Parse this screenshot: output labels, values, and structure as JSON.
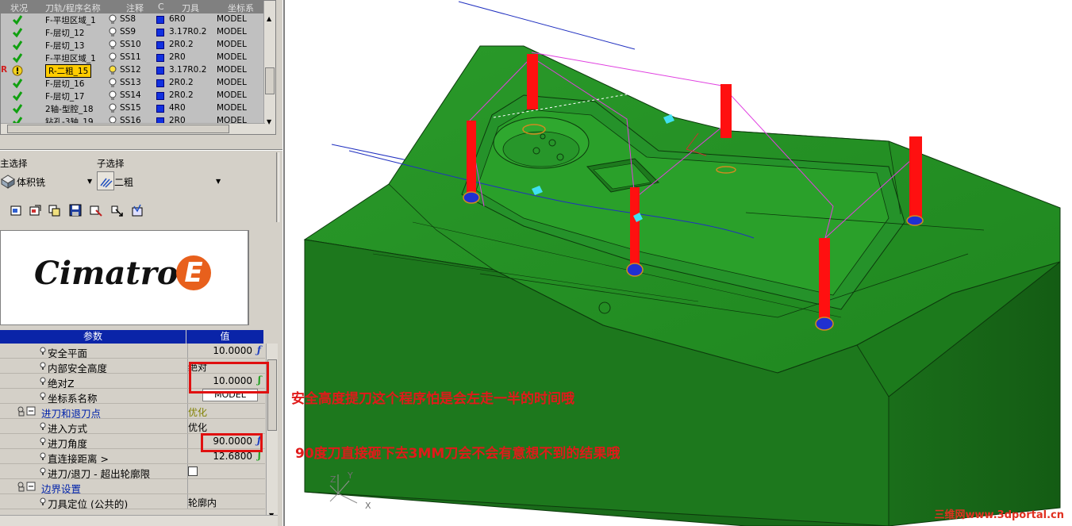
{
  "program_list": {
    "headers": [
      "状况",
      "刀轨/程序名称",
      "注释",
      "C",
      "刀具",
      "坐标系"
    ],
    "rows": [
      {
        "status": "ok",
        "name": "F-平坦区域_1",
        "note": "SS8",
        "tool": "6R0",
        "coord": "MODEL"
      },
      {
        "status": "ok",
        "name": "F-层切_12",
        "note": "SS9",
        "tool": "3.17R0.2",
        "coord": "MODEL"
      },
      {
        "status": "ok",
        "name": "F-层切_13",
        "note": "SS10",
        "tool": "2R0.2",
        "coord": "MODEL"
      },
      {
        "status": "ok",
        "name": "F-平坦区域_1",
        "note": "SS11",
        "tool": "2R0",
        "coord": "MODEL"
      },
      {
        "status": "warn",
        "name": "R-二粗_15",
        "note": "SS12",
        "tool": "3.17R0.2",
        "coord": "MODEL",
        "marker": "R"
      },
      {
        "status": "ok",
        "name": "F-层切_16",
        "note": "SS13",
        "tool": "2R0.2",
        "coord": "MODEL"
      },
      {
        "status": "ok",
        "name": "F-层切_17",
        "note": "SS14",
        "tool": "2R0.2",
        "coord": "MODEL"
      },
      {
        "status": "ok",
        "name": "2轴-型腔_18",
        "note": "SS15",
        "tool": "4R0",
        "coord": "MODEL"
      },
      {
        "status": "ok",
        "name": "钻孔-3轴_19",
        "note": "SS16",
        "tool": "2R0",
        "coord": "MODEL"
      }
    ]
  },
  "selection": {
    "main_label": "主选择",
    "main_value": "体积铣",
    "sub_label": "子选择",
    "sub_value": "二粗"
  },
  "logo": {
    "text": "Cimatron",
    "letter": "E"
  },
  "params": {
    "header_name": "参数",
    "header_value": "值",
    "rows": [
      {
        "name": "安全平面",
        "value": "10.0000",
        "fx": "ƒ",
        "indent": 1
      },
      {
        "name": "内部安全高度",
        "value": "绝对",
        "indent": 1
      },
      {
        "name": "绝对Z",
        "value": "10.0000",
        "fx": "ʃ",
        "fx_color": "green",
        "indent": 1
      },
      {
        "name": "坐标系名称",
        "value": "MODEL",
        "indent": 1
      },
      {
        "name": "进刀和退刀点",
        "value": "优化",
        "group": true
      },
      {
        "name": "进入方式",
        "value": "优化",
        "indent": 1
      },
      {
        "name": "进刀角度",
        "value": "90.0000",
        "fx": "ƒ",
        "indent": 1
      },
      {
        "name": "直连接距离 >",
        "value": "12.6800",
        "fx": "ʃ",
        "fx_color": "green",
        "indent": 1
      },
      {
        "name": "进刀/退刀 - 超出轮廓限",
        "value": "",
        "checkbox": true,
        "indent": 1
      },
      {
        "name": "边界设置",
        "value": "",
        "group": true
      },
      {
        "name": "刀具定位 (公共的)",
        "value": "轮廓内",
        "indent": 1
      }
    ]
  },
  "annotations": {
    "note1": "安全高度提刀这个程序怕是会左走一半的时间哦",
    "note2": "90度刀直接砸下去3MM刀会不会有意想不到的结果哦"
  },
  "viewport": {
    "axis_labels": {
      "x": "X",
      "y": "Y",
      "z": "Z"
    },
    "watermark": "三维网www.3dportal.cn"
  },
  "colors": {
    "model_green": "#1f8a1f",
    "toolpath_red": "#ff1010",
    "annotation_red": "#e01a1a",
    "selected_row": "#ffcc00",
    "grid_header_blue": "#0a24a8"
  }
}
